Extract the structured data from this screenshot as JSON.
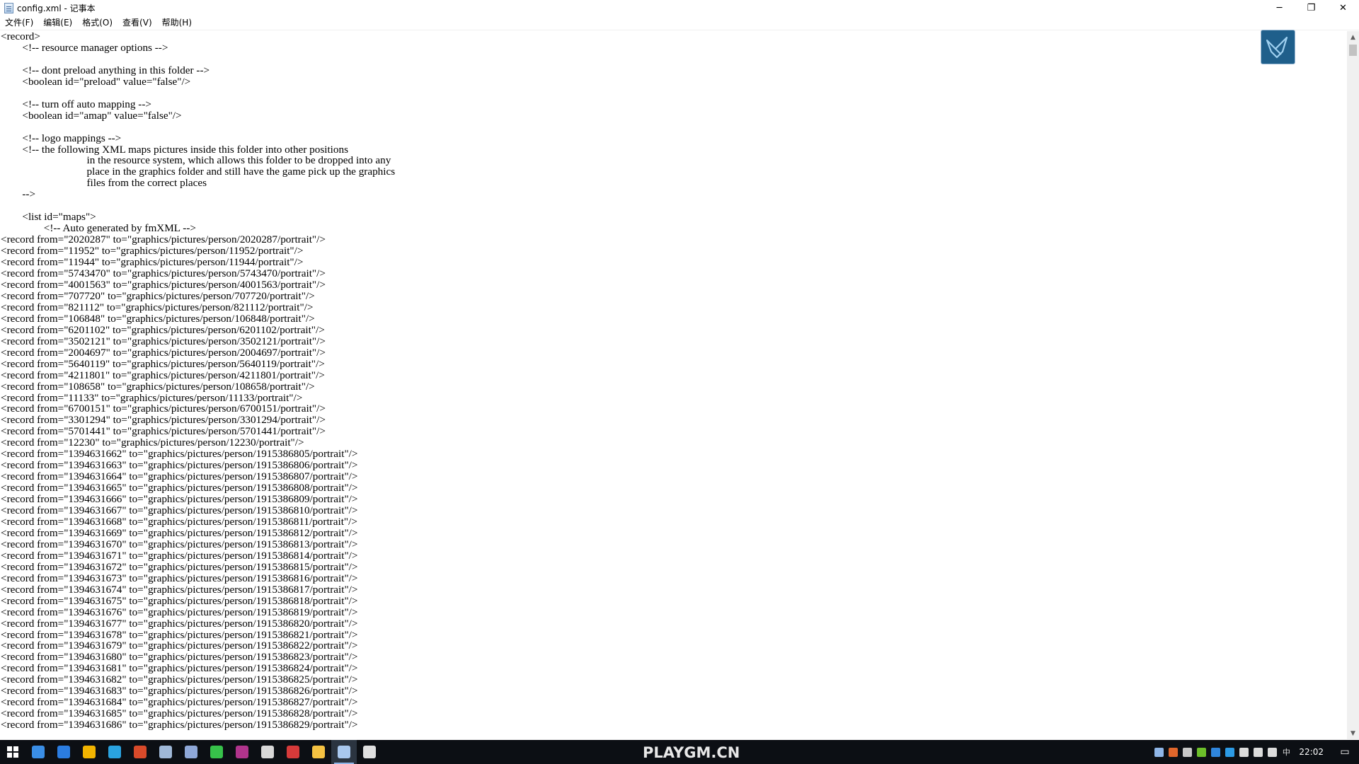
{
  "window": {
    "title": "config.xml - 记事本",
    "minimize_glyph": "─",
    "maximize_glyph": "❐",
    "close_glyph": "✕"
  },
  "menu": {
    "items": [
      "文件(F)",
      "编辑(E)",
      "格式(O)",
      "查看(V)",
      "帮助(H)"
    ]
  },
  "editor": {
    "text": "<record>\n\t<!-- resource manager options -->\n\n\t<!-- dont preload anything in this folder -->\n\t<boolean id=\"preload\" value=\"false\"/>\n\n\t<!-- turn off auto mapping -->\n\t<boolean id=\"amap\" value=\"false\"/>\n\n\t<!-- logo mappings -->\n\t<!-- the following XML maps pictures inside this folder into other positions\n\t\t\t\tin the resource system, which allows this folder to be dropped into any\n\t\t\t\tplace in the graphics folder and still have the game pick up the graphics\n\t\t\t\tfiles from the correct places\n\t-->\n\n\t<list id=\"maps\">\n\t\t<!-- Auto generated by fmXML -->\n<record from=\"2020287\" to=\"graphics/pictures/person/2020287/portrait\"/>\n<record from=\"11952\" to=\"graphics/pictures/person/11952/portrait\"/>\n<record from=\"11944\" to=\"graphics/pictures/person/11944/portrait\"/>\n<record from=\"5743470\" to=\"graphics/pictures/person/5743470/portrait\"/>\n<record from=\"4001563\" to=\"graphics/pictures/person/4001563/portrait\"/>\n<record from=\"707720\" to=\"graphics/pictures/person/707720/portrait\"/>\n<record from=\"821112\" to=\"graphics/pictures/person/821112/portrait\"/>\n<record from=\"106848\" to=\"graphics/pictures/person/106848/portrait\"/>\n<record from=\"6201102\" to=\"graphics/pictures/person/6201102/portrait\"/>\n<record from=\"3502121\" to=\"graphics/pictures/person/3502121/portrait\"/>\n<record from=\"2004697\" to=\"graphics/pictures/person/2004697/portrait\"/>\n<record from=\"5640119\" to=\"graphics/pictures/person/5640119/portrait\"/>\n<record from=\"4211801\" to=\"graphics/pictures/person/4211801/portrait\"/>\n<record from=\"108658\" to=\"graphics/pictures/person/108658/portrait\"/>\n<record from=\"11133\" to=\"graphics/pictures/person/11133/portrait\"/>\n<record from=\"6700151\" to=\"graphics/pictures/person/6700151/portrait\"/>\n<record from=\"3301294\" to=\"graphics/pictures/person/3301294/portrait\"/>\n<record from=\"5701441\" to=\"graphics/pictures/person/5701441/portrait\"/>\n<record from=\"12230\" to=\"graphics/pictures/person/12230/portrait\"/>\n<record from=\"1394631662\" to=\"graphics/pictures/person/1915386805/portrait\"/>\n<record from=\"1394631663\" to=\"graphics/pictures/person/1915386806/portrait\"/>\n<record from=\"1394631664\" to=\"graphics/pictures/person/1915386807/portrait\"/>\n<record from=\"1394631665\" to=\"graphics/pictures/person/1915386808/portrait\"/>\n<record from=\"1394631666\" to=\"graphics/pictures/person/1915386809/portrait\"/>\n<record from=\"1394631667\" to=\"graphics/pictures/person/1915386810/portrait\"/>\n<record from=\"1394631668\" to=\"graphics/pictures/person/1915386811/portrait\"/>\n<record from=\"1394631669\" to=\"graphics/pictures/person/1915386812/portrait\"/>\n<record from=\"1394631670\" to=\"graphics/pictures/person/1915386813/portrait\"/>\n<record from=\"1394631671\" to=\"graphics/pictures/person/1915386814/portrait\"/>\n<record from=\"1394631672\" to=\"graphics/pictures/person/1915386815/portrait\"/>\n<record from=\"1394631673\" to=\"graphics/pictures/person/1915386816/portrait\"/>\n<record from=\"1394631674\" to=\"graphics/pictures/person/1915386817/portrait\"/>\n<record from=\"1394631675\" to=\"graphics/pictures/person/1915386818/portrait\"/>\n<record from=\"1394631676\" to=\"graphics/pictures/person/1915386819/portrait\"/>\n<record from=\"1394631677\" to=\"graphics/pictures/person/1915386820/portrait\"/>\n<record from=\"1394631678\" to=\"graphics/pictures/person/1915386821/portrait\"/>\n<record from=\"1394631679\" to=\"graphics/pictures/person/1915386822/portrait\"/>\n<record from=\"1394631680\" to=\"graphics/pictures/person/1915386823/portrait\"/>\n<record from=\"1394631681\" to=\"graphics/pictures/person/1915386824/portrait\"/>\n<record from=\"1394631682\" to=\"graphics/pictures/person/1915386825/portrait\"/>\n<record from=\"1394631683\" to=\"graphics/pictures/person/1915386826/portrait\"/>\n<record from=\"1394631684\" to=\"graphics/pictures/person/1915386827/portrait\"/>\n<record from=\"1394631685\" to=\"graphics/pictures/person/1915386828/portrait\"/>\n<record from=\"1394631686\" to=\"graphics/pictures/person/1915386829/portrait\"/>"
  },
  "scrollbar": {
    "up_glyph": "▲",
    "down_glyph": "▼"
  },
  "overlay_app": {
    "icon": "bird-logo-icon"
  },
  "taskbar": {
    "watermark": "PLAYGM.CN",
    "icons": [
      {
        "name": "task-view-icon",
        "color": "#3a8ee6"
      },
      {
        "name": "store-icon",
        "color": "#2b7de1"
      },
      {
        "name": "chrome-icon",
        "color": "#f2b400"
      },
      {
        "name": "browser-icon",
        "color": "#2aa3e0"
      },
      {
        "name": "game-icon",
        "color": "#d94a2a"
      },
      {
        "name": "steam-icon",
        "color": "#9fb8d8"
      },
      {
        "name": "network-app-icon",
        "color": "#8fa8d8"
      },
      {
        "name": "wechat-icon",
        "color": "#37c24a"
      },
      {
        "name": "media-app-icon",
        "color": "#b0348c"
      },
      {
        "name": "circle-app-icon",
        "color": "#d8d8d8"
      },
      {
        "name": "z-app-icon",
        "color": "#d63a3a"
      },
      {
        "name": "file-explorer-icon",
        "color": "#f5c242"
      },
      {
        "name": "notepad-icon",
        "color": "#a9c8ee"
      },
      {
        "name": "fm-app-icon",
        "color": "#e0e0e0"
      }
    ],
    "active_index": 12,
    "tray_icons": [
      {
        "name": "steam-tray-icon",
        "color": "#8fb6e8"
      },
      {
        "name": "office-tray-icon",
        "color": "#e0662b"
      },
      {
        "name": "keyboard-tray-icon",
        "color": "#c8c8c8"
      },
      {
        "name": "nvidia-tray-icon",
        "color": "#6cbf2a"
      },
      {
        "name": "dropbox-tray-icon",
        "color": "#2f86de"
      },
      {
        "name": "tencent-tray-icon",
        "color": "#2c9be6"
      },
      {
        "name": "battery-tray-icon",
        "color": "#dcdcdc"
      },
      {
        "name": "wifi-tray-icon",
        "color": "#dcdcdc"
      },
      {
        "name": "volume-tray-icon",
        "color": "#dcdcdc"
      }
    ],
    "ime_label": "中",
    "clock": "22:02",
    "notification_glyph": "▭"
  }
}
